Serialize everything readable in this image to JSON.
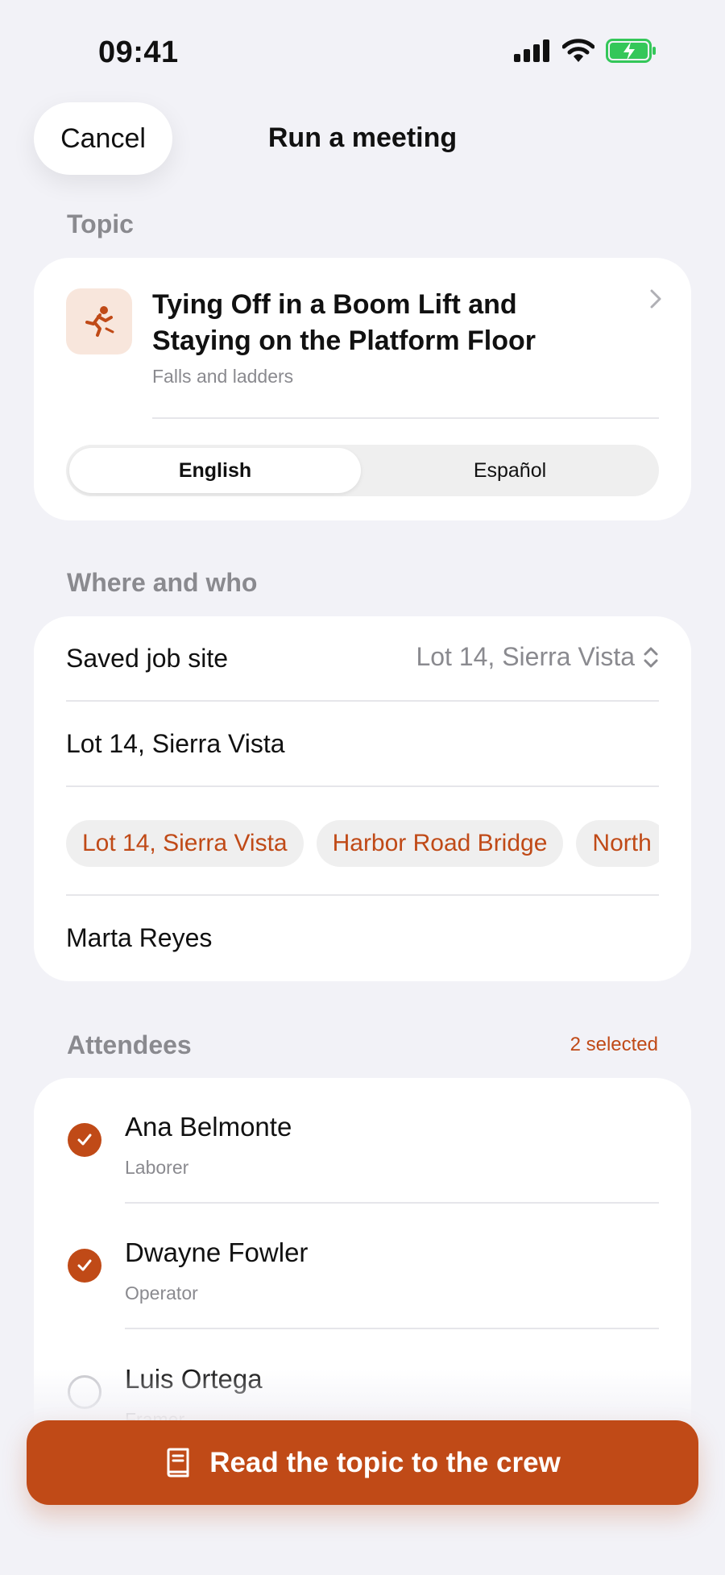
{
  "status_bar": {
    "time": "09:41"
  },
  "nav": {
    "cancel_label": "Cancel",
    "title": "Run a meeting"
  },
  "topic_section": {
    "label": "Topic",
    "title": "Tying Off in a Boom Lift and Staying on the Platform Floor",
    "category": "Falls and ladders",
    "icon": "falling-person-icon",
    "languages": [
      {
        "label": "English",
        "selected": true
      },
      {
        "label": "Español",
        "selected": false
      }
    ]
  },
  "where_section": {
    "label": "Where and who",
    "saved_site_label": "Saved job site",
    "saved_site_value": "Lot 14, Sierra Vista",
    "site_input_value": "Lot 14, Sierra Vista",
    "site_chips": [
      "Lot 14, Sierra Vista",
      "Harbor Road Bridge",
      "North"
    ],
    "leader_name": "Marta Reyes"
  },
  "attendees_section": {
    "label": "Attendees",
    "selected_count": "2 selected",
    "items": [
      {
        "name": "Ana Belmonte",
        "role": "Laborer",
        "checked": true
      },
      {
        "name": "Dwayne Fowler",
        "role": "Operator",
        "checked": true
      },
      {
        "name": "Luis Ortega",
        "role": "Framer",
        "checked": false
      }
    ]
  },
  "cta": {
    "label": "Read the topic to the crew",
    "icon": "book-icon"
  },
  "colors": {
    "accent": "#c04a17",
    "background": "#f2f2f7",
    "chip_bg": "#efefef",
    "icon_tint_bg": "#f8e6dc"
  }
}
